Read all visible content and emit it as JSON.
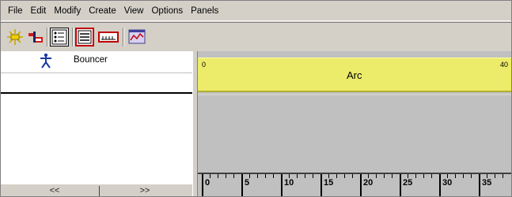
{
  "menu": [
    "File",
    "Edit",
    "Modify",
    "Create",
    "View",
    "Options",
    "Panels"
  ],
  "toolbar": {
    "icons": [
      "sun-burst-icon",
      "track-link-icon",
      "list-panel-icon",
      "stacked-lines-icon",
      "ruler-bar-icon",
      "graph-window-icon"
    ]
  },
  "actor": {
    "name": "Bouncer",
    "icon": "stick-figure-icon"
  },
  "left_nav": {
    "prev": "<<",
    "next": ">>"
  },
  "track": {
    "label": "Arc",
    "start": "0",
    "end": "40",
    "color": "#ecec6a"
  },
  "ruler": {
    "ticks": [
      "0",
      "5",
      "10",
      "15",
      "20",
      "25",
      "30",
      "35"
    ]
  }
}
